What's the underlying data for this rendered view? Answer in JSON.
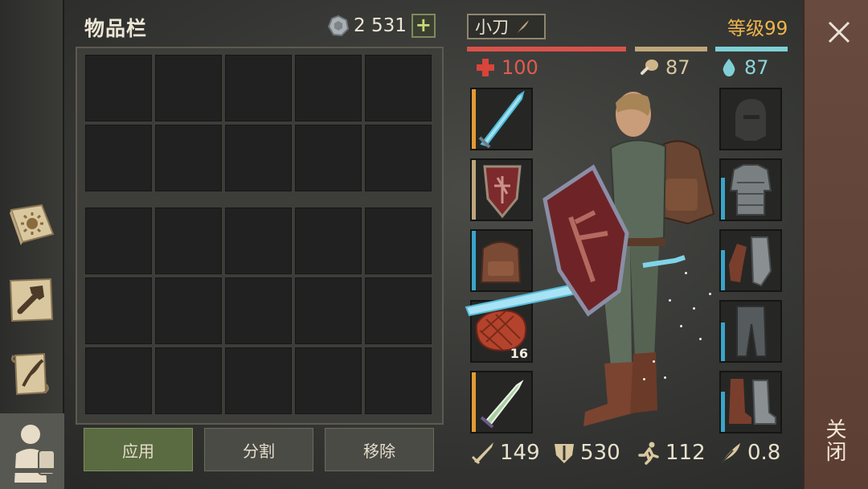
{
  "inventory": {
    "title": "物品栏",
    "coins": "2 531",
    "plus": "+"
  },
  "buttons": {
    "apply": "应用",
    "split": "分割",
    "remove": "移除"
  },
  "character": {
    "weapon_name": "小刀",
    "level": "等级99"
  },
  "stats_top": {
    "health": "100",
    "food": "87",
    "water": "87"
  },
  "slots": {
    "meat_count": "16"
  },
  "stats_bottom": {
    "attack": "149",
    "defense": "530",
    "speed": "112",
    "weight": "0.8"
  },
  "close": {
    "label": "关闭"
  },
  "colors": {
    "health": "#d9534a",
    "food": "#bfa67a",
    "water": "#7fd0d6",
    "accent_orange": "#e39a33",
    "accent_teal": "#3aa4c8"
  }
}
